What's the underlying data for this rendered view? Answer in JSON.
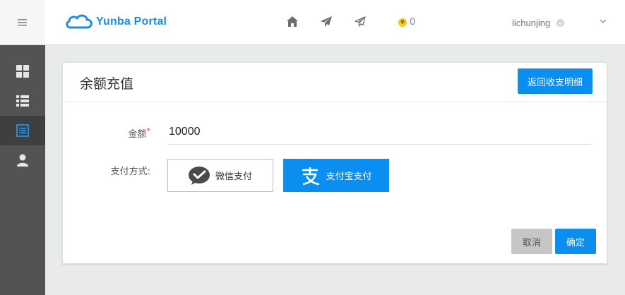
{
  "app": {
    "brand": "Yunba Portal"
  },
  "header": {
    "coin_symbol": "¥",
    "coin_count": "0",
    "username": "lichunjing"
  },
  "sidebar": {
    "items": [
      {
        "icon": "dashboard-grid-icon",
        "active": false
      },
      {
        "icon": "list-icon",
        "active": false
      },
      {
        "icon": "document-list-icon",
        "active": true
      },
      {
        "icon": "user-icon",
        "active": false
      }
    ]
  },
  "page": {
    "title": "余额充值",
    "back_button": "返回收支明细",
    "amount_label": "金额",
    "amount_required_mark": "*",
    "amount_value": "10000",
    "payment_label": "支付方式:",
    "pay_wechat": "微信支付",
    "pay_alipay": "支付宝支付",
    "cancel": "取消",
    "confirm": "确定"
  },
  "colors": {
    "accent": "#0a8ef0",
    "sidebar": "#535353",
    "sidebar_active": "#3f3f3f",
    "coin": "#f3c91d"
  }
}
